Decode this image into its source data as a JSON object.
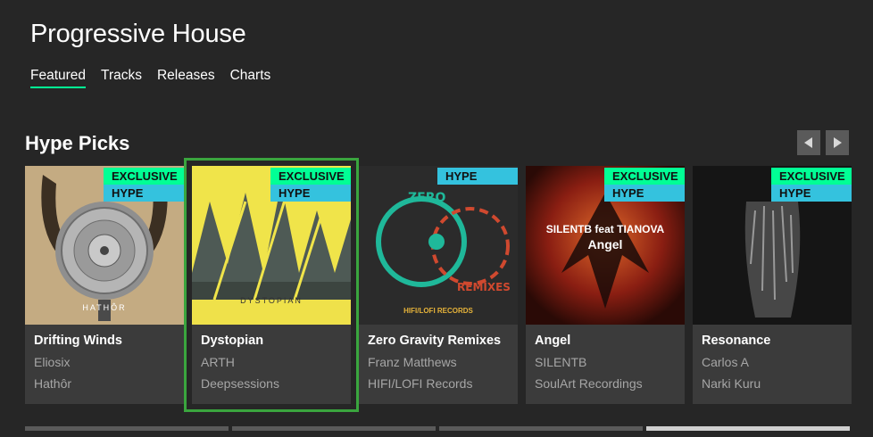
{
  "header": {
    "title": "Progressive House"
  },
  "tabs": [
    {
      "label": "Featured",
      "active": true
    },
    {
      "label": "Tracks",
      "active": false
    },
    {
      "label": "Releases",
      "active": false
    },
    {
      "label": "Charts",
      "active": false
    }
  ],
  "section": {
    "title": "Hype Picks"
  },
  "nav": {
    "prev_icon": "triangle-left",
    "next_icon": "triangle-right"
  },
  "cards": [
    {
      "name": "Drifting Winds",
      "artist": "Eliosix",
      "label": "Hathôr",
      "badges": [
        "EXCLUSIVE",
        "HYPE"
      ],
      "art_text": "HATHÔR"
    },
    {
      "name": "Dystopian",
      "artist": "ARTH",
      "label": "Deepsessions",
      "badges": [
        "EXCLUSIVE",
        "HYPE"
      ],
      "art_text": "DYSTOPIAN",
      "selected": true
    },
    {
      "name": "Zero Gravity Remixes",
      "artist": "Franz Matthews",
      "label": "HIFI/LOFI Records",
      "badges": [
        "HYPE"
      ],
      "art_text": "HIFI/LOFI RECORDS"
    },
    {
      "name": "Angel",
      "artist": "SILENTB",
      "label": "SoulArt Recordings",
      "badges": [
        "EXCLUSIVE",
        "HYPE"
      ],
      "art_text": "SILENTB feat TIANOVA",
      "art_text2": "Angel"
    },
    {
      "name": "Resonance",
      "artist": "Carlos A",
      "label": "Narki Kuru",
      "badges": [
        "EXCLUSIVE",
        "HYPE"
      ],
      "art_text": ""
    }
  ],
  "colors": {
    "exclusive": "#01ff95",
    "hype": "#34c2de",
    "selection": "#3aa53e",
    "background": "#262626",
    "card": "#3b3b3b"
  },
  "scroll": {
    "pages": 4,
    "active_page": 4
  }
}
